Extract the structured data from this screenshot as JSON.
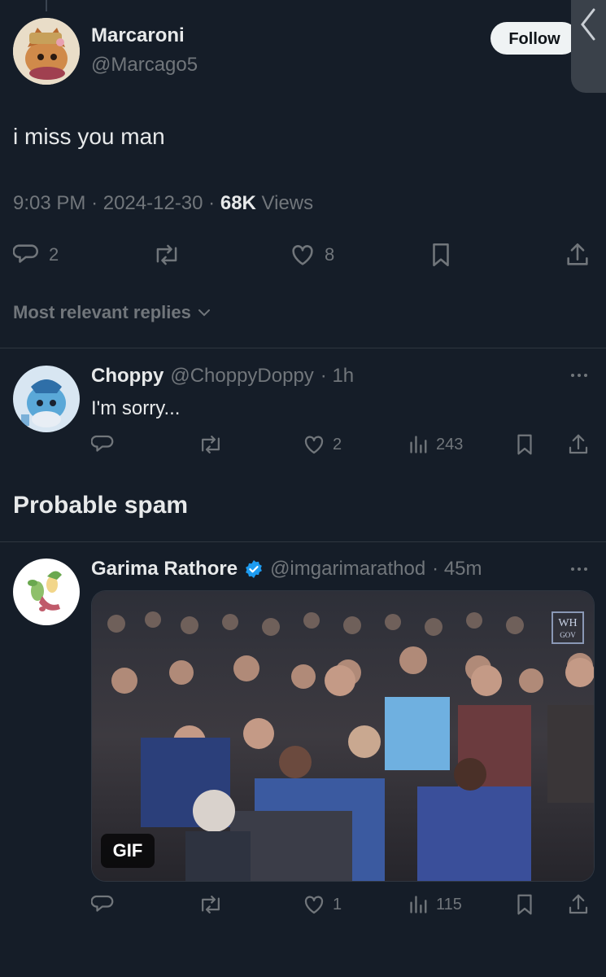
{
  "tweet": {
    "display_name": "Marcaroni",
    "handle": "@Marcago5",
    "follow_label": "Follow",
    "text": "i miss you man",
    "time": "9:03 PM",
    "sep1": "·",
    "date": "2024-12-30",
    "sep2": "·",
    "views_count": "68K",
    "views_label": "Views",
    "replies": "2",
    "likes": "8"
  },
  "sort": {
    "label": "Most relevant replies"
  },
  "replies": [
    {
      "name": "Choppy",
      "handle": "@ChoppyDoppy",
      "time": "· 1h",
      "text": "I'm sorry...",
      "likes": "2",
      "views": "243"
    }
  ],
  "spam_section": {
    "title": "Probable spam"
  },
  "spam_replies": [
    {
      "name": "Garima Rathore",
      "handle": "@imgarimarathod",
      "time": "· 45m",
      "verified": true,
      "media_badge": "GIF",
      "media_logo_line1": "WH",
      "media_logo_line2": "GOV",
      "likes": "1",
      "views": "115"
    }
  ],
  "colors": {
    "background": "#151d28",
    "text_primary": "#e7e9ea",
    "text_secondary": "#71767b",
    "verified": "#1d9bf0",
    "follow_bg": "#eff3f4"
  },
  "icons": {
    "reply": "speech-bubble-icon",
    "retweet": "retweet-icon",
    "like": "heart-icon",
    "bookmark": "bookmark-icon",
    "share": "share-icon",
    "views": "bar-chart-icon",
    "more": "more-dots-icon",
    "chevron": "chevron-down-icon"
  }
}
